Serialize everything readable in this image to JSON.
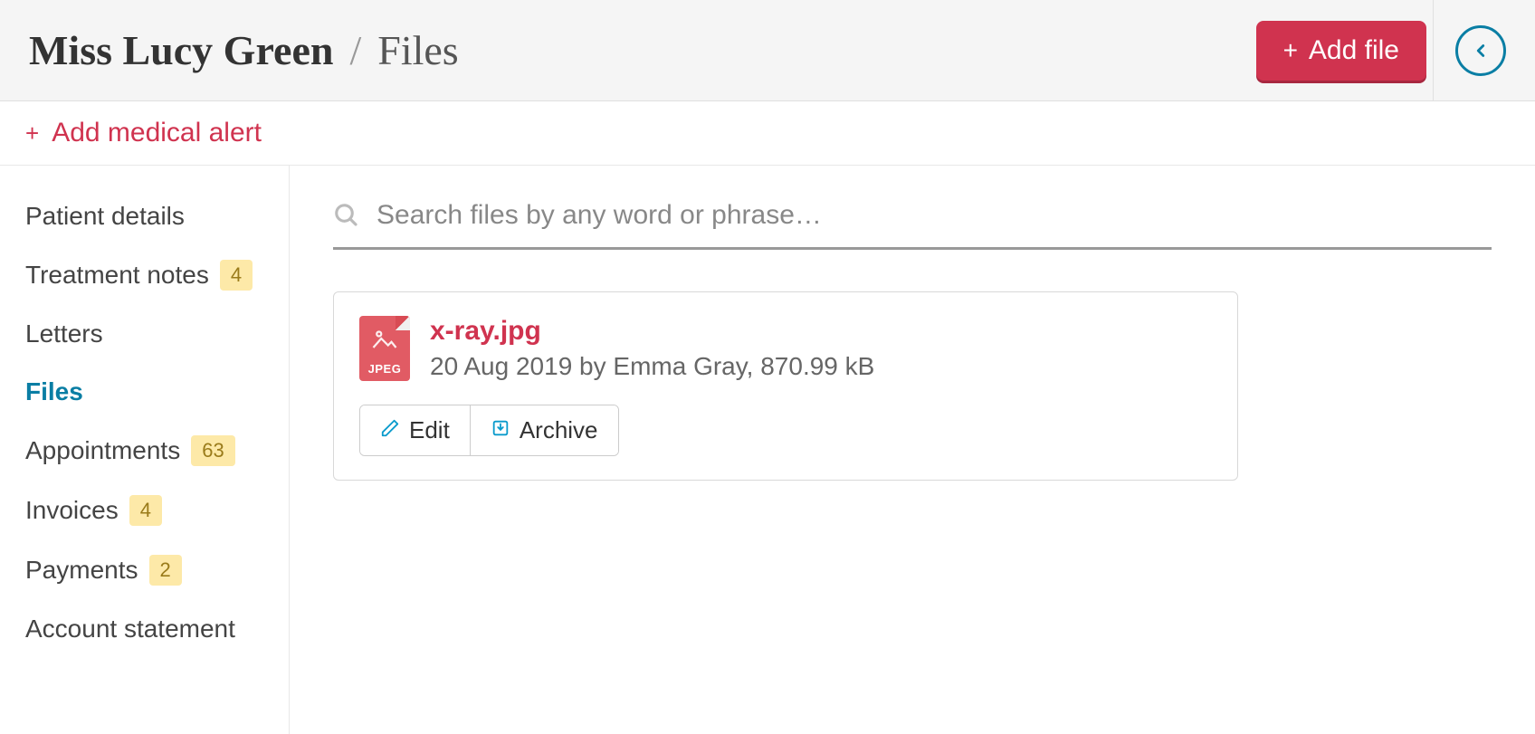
{
  "header": {
    "patient_name": "Miss Lucy Green",
    "separator": "/",
    "section": "Files",
    "add_file_label": "Add file"
  },
  "alert": {
    "add_label": "Add medical alert"
  },
  "sidebar": {
    "items": [
      {
        "label": "Patient details",
        "badge": null,
        "active": false
      },
      {
        "label": "Treatment notes",
        "badge": "4",
        "active": false
      },
      {
        "label": "Letters",
        "badge": null,
        "active": false
      },
      {
        "label": "Files",
        "badge": null,
        "active": true
      },
      {
        "label": "Appointments",
        "badge": "63",
        "active": false
      },
      {
        "label": "Invoices",
        "badge": "4",
        "active": false
      },
      {
        "label": "Payments",
        "badge": "2",
        "active": false
      },
      {
        "label": "Account statement",
        "badge": null,
        "active": false
      }
    ]
  },
  "search": {
    "placeholder": "Search files by any word or phrase…"
  },
  "file": {
    "ext": "JPEG",
    "name": "x-ray.jpg",
    "meta": "20 Aug 2019 by Emma Gray, 870.99 kB",
    "edit_label": "Edit",
    "archive_label": "Archive"
  }
}
